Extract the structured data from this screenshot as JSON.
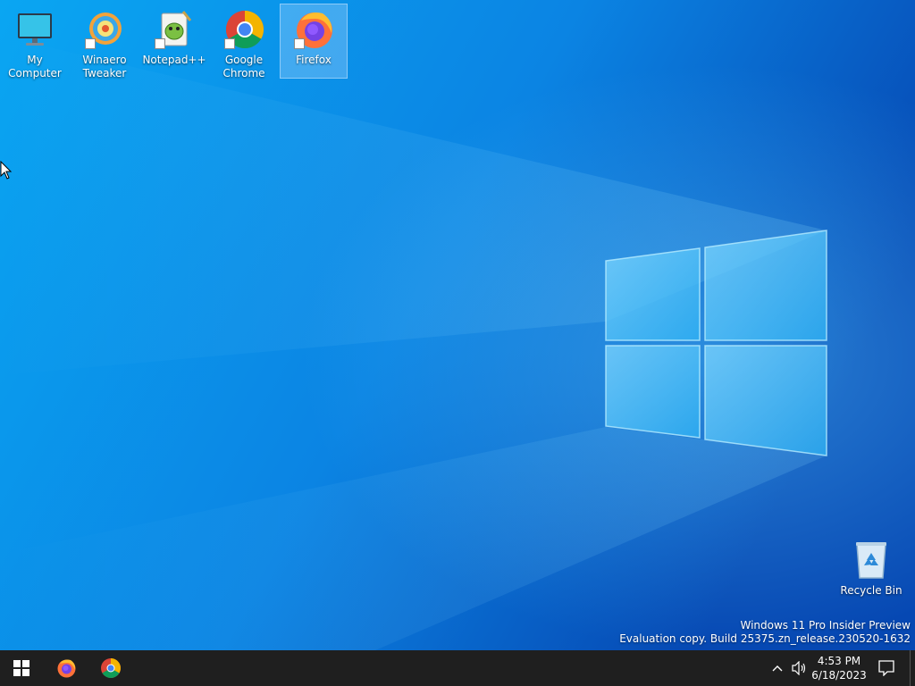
{
  "desktop": {
    "icons": [
      {
        "label": "My Computer",
        "icon": "monitor-icon",
        "shortcut": false,
        "selected": false
      },
      {
        "label": "Winaero Tweaker",
        "icon": "winaero-tweaker-icon",
        "shortcut": true,
        "selected": false
      },
      {
        "label": "Notepad++",
        "icon": "notepadpp-icon",
        "shortcut": true,
        "selected": false
      },
      {
        "label": "Google Chrome",
        "icon": "chrome-icon",
        "shortcut": true,
        "selected": false
      },
      {
        "label": "Firefox",
        "icon": "firefox-icon",
        "shortcut": true,
        "selected": true
      }
    ],
    "recycle_bin": {
      "label": "Recycle Bin",
      "icon": "recycle-bin-icon"
    }
  },
  "watermark": {
    "line1": "Windows 11 Pro Insider Preview",
    "line2": "Evaluation copy. Build 25375.zn_release.230520-1632"
  },
  "taskbar": {
    "start_icon": "windows-logo-icon",
    "pinned": [
      {
        "name": "Firefox",
        "icon": "firefox-icon"
      },
      {
        "name": "Google Chrome",
        "icon": "chrome-icon"
      }
    ],
    "tray": {
      "chevron_icon": "chevron-up-icon",
      "volume_icon": "speaker-icon",
      "time": "4:53 PM",
      "date": "6/18/2023",
      "notification_icon": "notification-icon"
    }
  },
  "colors": {
    "wallpaper_base": "#0a63c9",
    "taskbar": "#1f1f1f",
    "accent": "#1ea0f0"
  }
}
